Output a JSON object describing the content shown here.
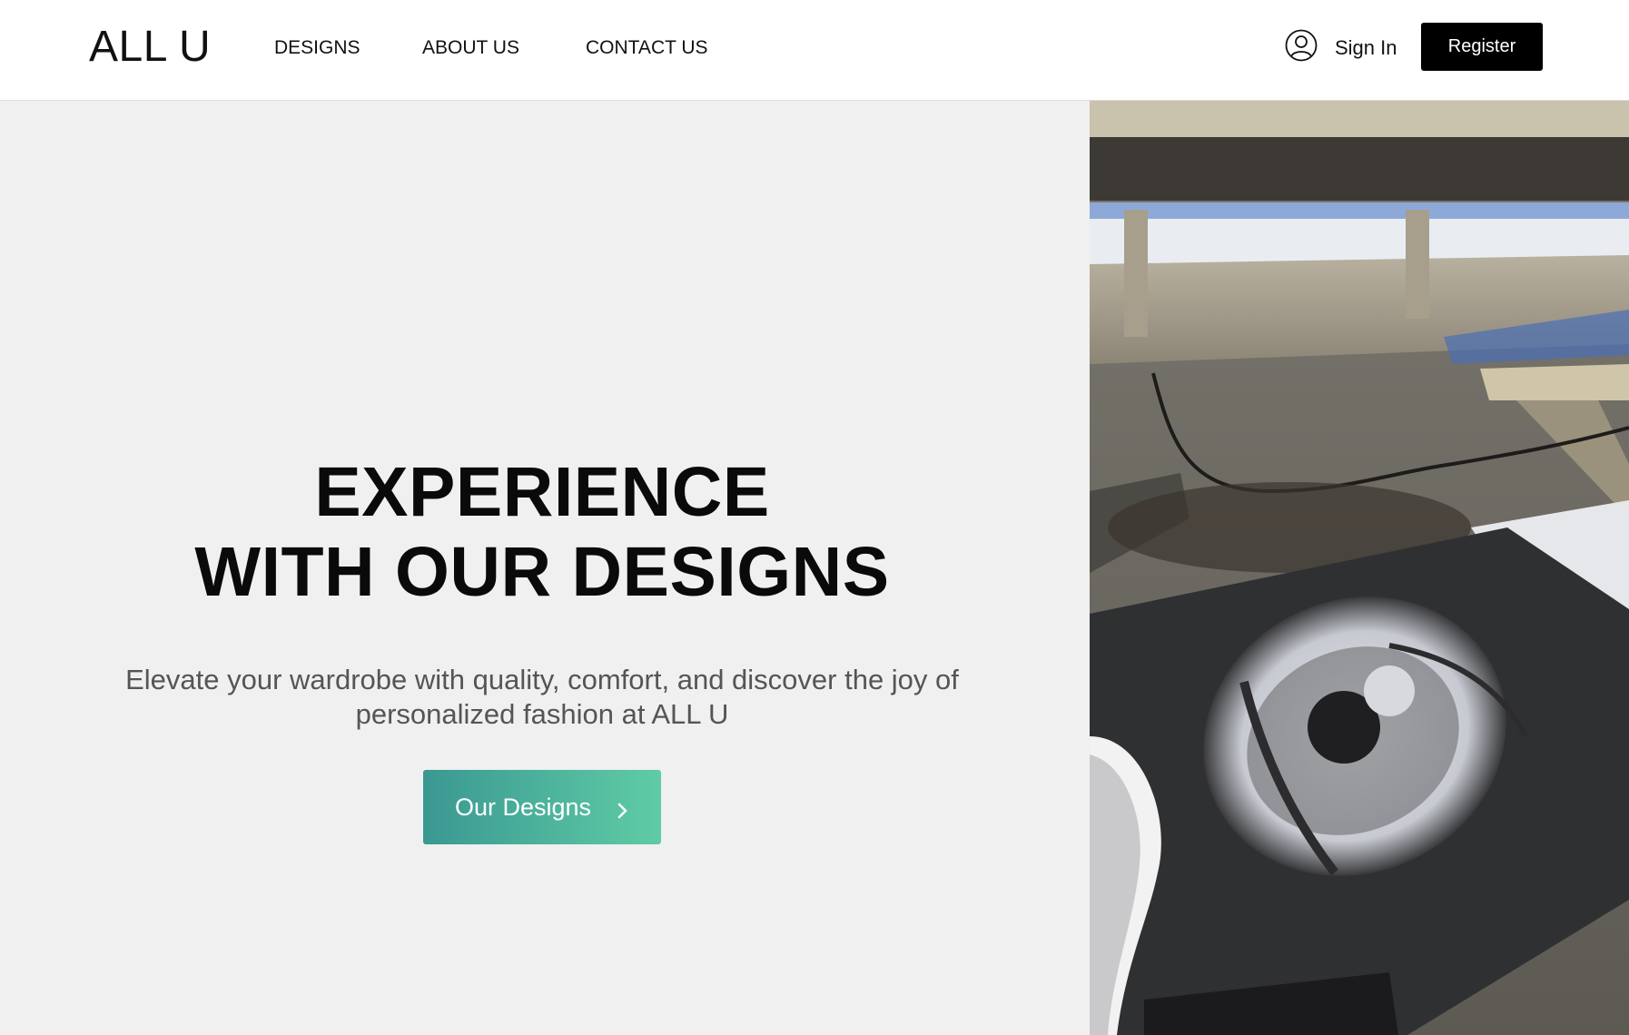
{
  "header": {
    "logo": "ALL U",
    "nav": [
      {
        "label": "DESIGNS"
      },
      {
        "label": "ABOUT US"
      },
      {
        "label": "CONTACT US"
      }
    ],
    "signin_label": "Sign In",
    "register_label": "Register",
    "user_icon": "user-circle-icon"
  },
  "hero": {
    "title_line1": "EXPERIENCE",
    "title_line2": "WITH OUR DESIGNS",
    "subtitle": "Elevate your wardrobe with quality, comfort, and discover the joy of personalized fashion at ALL U",
    "cta_label": "Our Designs",
    "cta_icon": "chevron-right-icon",
    "image": "screen-printing-machine-photo"
  },
  "colors": {
    "cta_gradient_start": "#3a9892",
    "cta_gradient_end": "#5fcca5",
    "register_bg": "#000000",
    "hero_bg": "#f0f0f0"
  }
}
